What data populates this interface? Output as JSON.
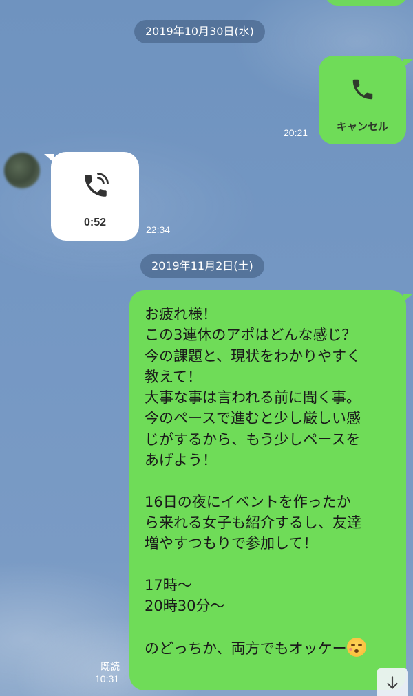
{
  "dates": {
    "first": "2019年10月30日(水)",
    "second": "2019年11月2日(土)"
  },
  "outgoing_call": {
    "icon": "phone-icon",
    "label": "キャンセル",
    "time": "20:21"
  },
  "incoming_call": {
    "icon": "phone-call-icon",
    "duration": "0:52",
    "time": "22:34"
  },
  "message": {
    "text": "お疲れ様！\nこの3連休のアポはどんな感じ？\n今の課題と、現状をわかりやすく\n教えて！\n大事な事は言われる前に聞く事。\n今のペースで進むと少し厳しい感\nじがするから、もう少しペースを\nあげよう！\n\n16日の夜にイベントを作ったか\nら来れる女子も紹介するし、友達\n増やすつもりで参加して！\n\n17時〜\n20時30分〜\n\nのどっちか、両方でもオッケー",
    "emoji": "kissing-face-emoji",
    "read_label": "既読",
    "time": "10:31"
  },
  "scroll_button": {
    "icon": "arrow-down-icon"
  },
  "colors": {
    "bubble_green": "#6fdc58",
    "background_blue": "#7497c3"
  }
}
